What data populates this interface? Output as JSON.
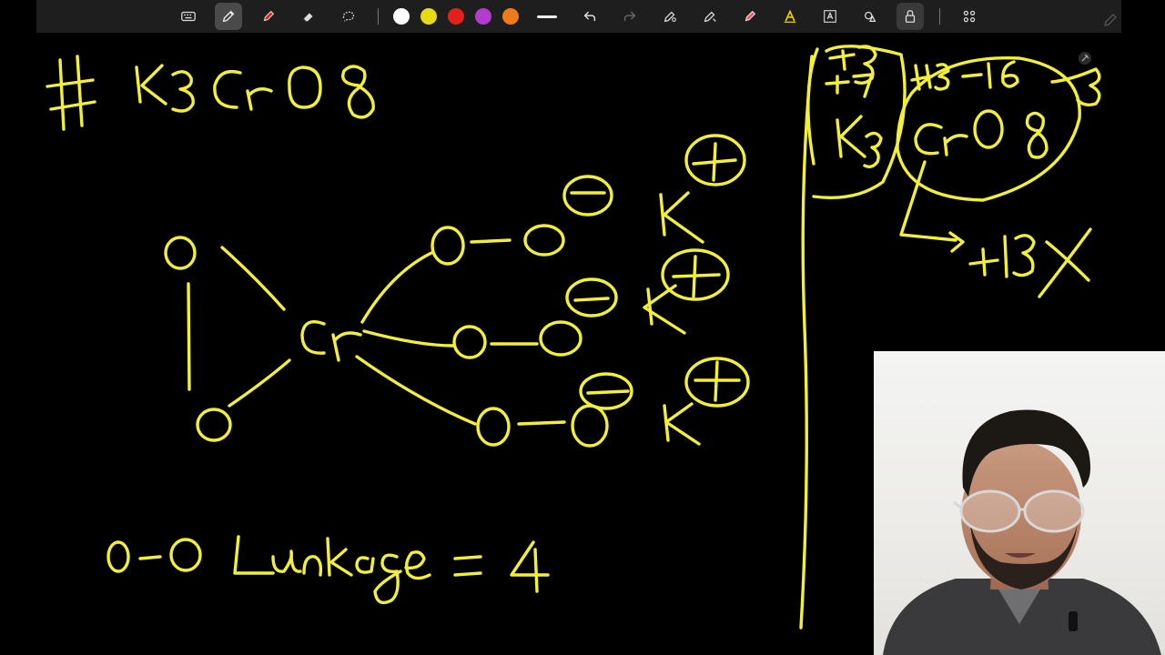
{
  "toolbar": {
    "tools": [
      {
        "name": "keyboard-icon"
      },
      {
        "name": "pen-icon"
      },
      {
        "name": "marker-icon"
      },
      {
        "name": "eraser-icon"
      },
      {
        "name": "lasso-icon"
      }
    ],
    "colors": [
      "#ffffff",
      "#e8d81a",
      "#e2201c",
      "#b23ccf",
      "#f07a1a"
    ],
    "right_tools": [
      {
        "name": "line-tool-icon"
      },
      {
        "name": "undo-icon"
      },
      {
        "name": "redo-icon"
      },
      {
        "name": "pen-settings-icon"
      },
      {
        "name": "laser-pen-icon"
      },
      {
        "name": "highlighter-icon"
      },
      {
        "name": "text-tool-icon"
      },
      {
        "name": "ocr-text-icon"
      },
      {
        "name": "shapes-icon"
      },
      {
        "name": "lock-icon"
      },
      {
        "name": "more-apps-icon"
      }
    ],
    "ink_color": "#f2ef3c",
    "background_color": "#000000"
  },
  "webcam": {
    "present": true
  }
}
